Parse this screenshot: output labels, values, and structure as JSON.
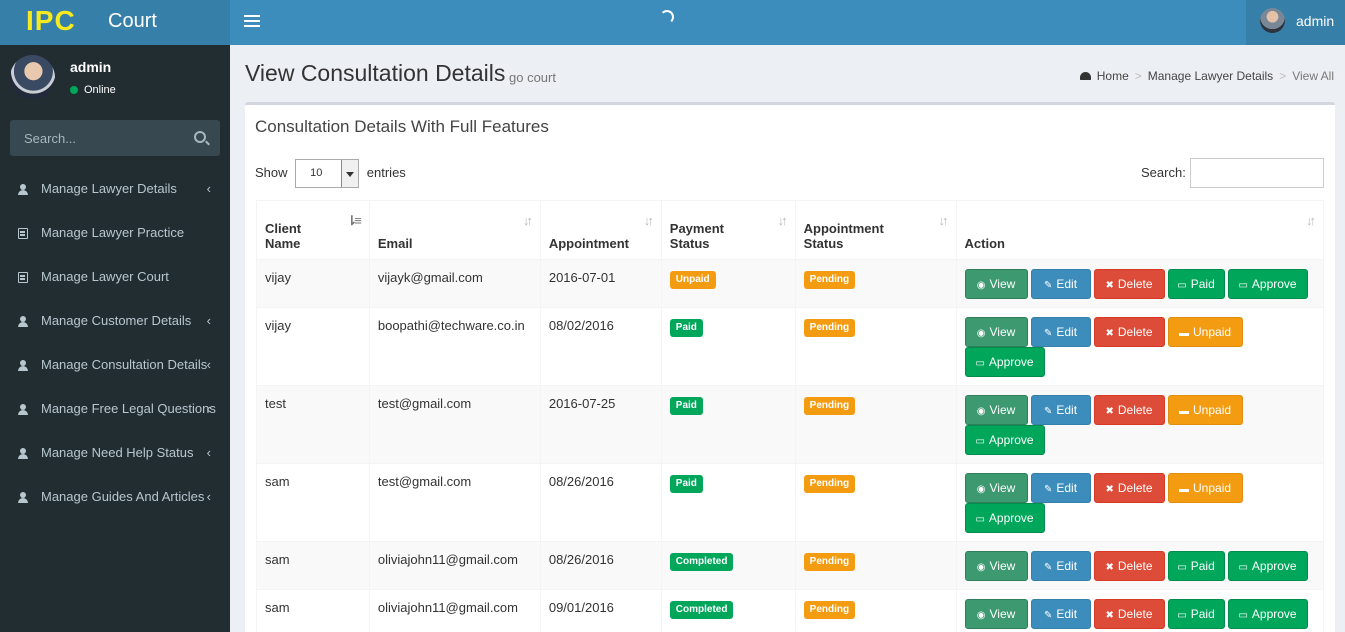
{
  "header": {
    "brand": "IPC",
    "brand_sub": "Court",
    "user_name": "admin"
  },
  "sidebar": {
    "user_name": "admin",
    "status": "Online",
    "search_placeholder": "Search...",
    "items": [
      {
        "label": "Manage Lawyer Details",
        "icon": "user-icon",
        "chevron": "‹"
      },
      {
        "label": "Manage Lawyer Practice",
        "icon": "document-icon",
        "chevron": ""
      },
      {
        "label": "Manage Lawyer Court",
        "icon": "document-icon",
        "chevron": ""
      },
      {
        "label": "Manage Customer Details",
        "icon": "user-icon",
        "chevron": "‹"
      },
      {
        "label": "Manage Consultation Details",
        "icon": "user-icon",
        "chevron": "‹"
      },
      {
        "label": "Manage Free Legal Questions",
        "icon": "user-icon",
        "chevron": "‹"
      },
      {
        "label": "Manage Need Help Status",
        "icon": "user-icon",
        "chevron": "‹"
      },
      {
        "label": "Manage Guides And Articles",
        "icon": "user-icon",
        "chevron": "‹"
      }
    ]
  },
  "content": {
    "title": "View Consultation Details",
    "subtitle": "go court",
    "breadcrumb": {
      "home": "Home",
      "parent": "Manage Lawyer Details",
      "current": "View All"
    }
  },
  "box": {
    "title": "Consultation Details With Full Features",
    "show_label": "Show",
    "entries_value": "10",
    "entries_label": "entries",
    "search_label": "Search:"
  },
  "table": {
    "headers": [
      {
        "line1": "Client",
        "line2": "Name"
      },
      {
        "line1": "",
        "line2": "Email"
      },
      {
        "line1": "",
        "line2": "Appointment"
      },
      {
        "line1": "Payment",
        "line2": "Status"
      },
      {
        "line1": "Appointment",
        "line2": "Status"
      },
      {
        "line1": "",
        "line2": "Action"
      }
    ],
    "buttons": {
      "view": "View",
      "edit": "Edit",
      "delete": "Delete",
      "paid": "Paid",
      "unpaid": "Unpaid",
      "approve": "Approve"
    },
    "rows": [
      {
        "name": "vijay",
        "email": "vijayk@gmail.com",
        "date": "2016-07-01",
        "payment": "Unpaid",
        "appointment": "Pending"
      },
      {
        "name": "vijay",
        "email": "boopathi@techware.co.in",
        "date": "08/02/2016",
        "payment": "Paid",
        "appointment": "Pending"
      },
      {
        "name": "test",
        "email": "test@gmail.com",
        "date": "2016-07-25",
        "payment": "Paid",
        "appointment": "Pending"
      },
      {
        "name": "sam",
        "email": "test@gmail.com",
        "date": "08/26/2016",
        "payment": "Paid",
        "appointment": "Pending"
      },
      {
        "name": "sam",
        "email": "oliviajohn11@gmail.com",
        "date": "08/26/2016",
        "payment": "Completed",
        "appointment": "Pending"
      },
      {
        "name": "sam",
        "email": "oliviajohn11@gmail.com",
        "date": "09/01/2016",
        "payment": "Completed",
        "appointment": "Pending"
      }
    ]
  },
  "colors": {
    "topbar": "#3c8dbc",
    "logo_bg": "#367fa9",
    "brand": "#f5ea1f",
    "sidebar": "#222d32",
    "paid": "#00a65a",
    "pending": "#f39c12",
    "delete": "#dd4b39"
  }
}
